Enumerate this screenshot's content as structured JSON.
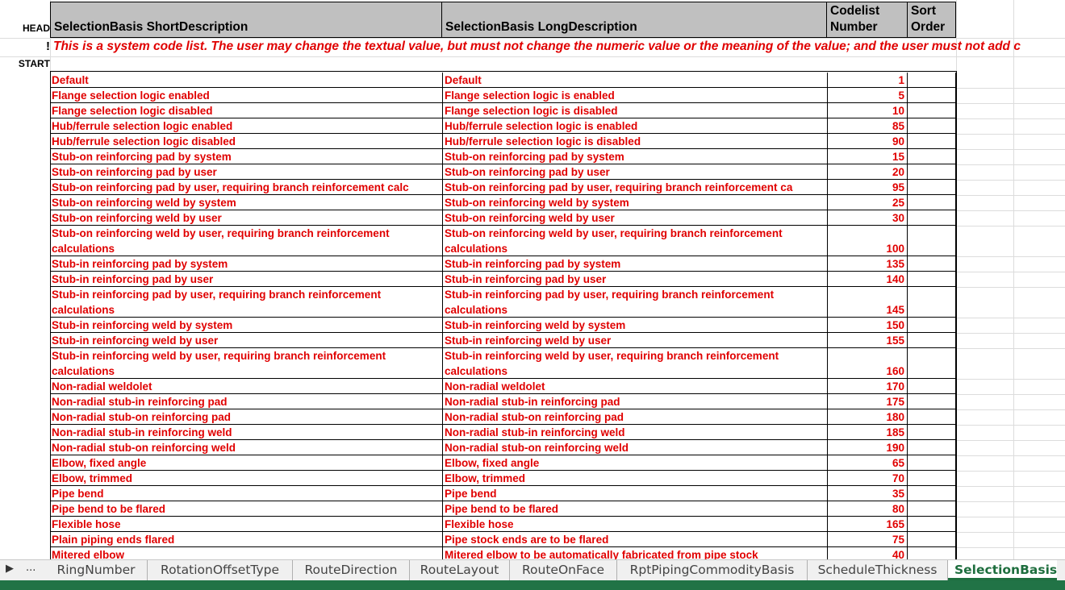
{
  "row_headers": {
    "head": "HEAD",
    "note_marker": "!",
    "start": "START"
  },
  "columns": {
    "short": "SelectionBasis ShortDescription",
    "long": "SelectionBasis LongDescription",
    "codelist": "Codelist Number",
    "sort": "Sort Order"
  },
  "note": "This is a system code list. The user may change the textual value, but must not change the numeric value or the meaning of the value; and the user must not add c",
  "rows": [
    {
      "short": "Default",
      "long": "Default",
      "num": "1"
    },
    {
      "short": "Flange selection logic enabled",
      "long": "Flange selection logic is enabled",
      "num": "5"
    },
    {
      "short": "Flange selection logic disabled",
      "long": "Flange selection logic is disabled",
      "num": "10"
    },
    {
      "short": "Hub/ferrule selection logic enabled",
      "long": "Hub/ferrule selection logic is enabled",
      "num": "85"
    },
    {
      "short": "Hub/ferrule selection logic disabled",
      "long": "Hub/ferrule selection logic is disabled",
      "num": "90"
    },
    {
      "short": "Stub-on reinforcing pad by system",
      "long": "Stub-on reinforcing pad by system",
      "num": "15"
    },
    {
      "short": "Stub-on reinforcing pad by user",
      "long": "Stub-on reinforcing pad by user",
      "num": "20"
    },
    {
      "short": "Stub-on reinforcing pad by user, requiring branch reinforcement calc",
      "long": "Stub-on reinforcing pad by user, requiring branch reinforcement ca",
      "num": "95"
    },
    {
      "short": "Stub-on reinforcing weld by system",
      "long": "Stub-on reinforcing weld by system",
      "num": "25"
    },
    {
      "short": "Stub-on reinforcing weld by user",
      "long": "Stub-on reinforcing weld by user",
      "num": "30"
    },
    {
      "short": "Stub-on reinforcing weld by user, requiring branch reinforcement calculations",
      "long": "Stub-on reinforcing weld by user, requiring branch reinforcement calculations",
      "num": "100",
      "wrap": true
    },
    {
      "short": "Stub-in reinforcing pad by system",
      "long": "Stub-in reinforcing pad by system",
      "num": "135"
    },
    {
      "short": "Stub-in reinforcing pad by user",
      "long": "Stub-in reinforcing pad by user",
      "num": "140"
    },
    {
      "short": "Stub-in reinforcing pad by user, requiring branch reinforcement calculations",
      "long": "Stub-in reinforcing pad by user, requiring branch reinforcement calculations",
      "num": "145",
      "wrap": true
    },
    {
      "short": "Stub-in reinforcing weld by system",
      "long": "Stub-in reinforcing weld by system",
      "num": "150"
    },
    {
      "short": "Stub-in reinforcing weld by user",
      "long": "Stub-in reinforcing weld by user",
      "num": "155"
    },
    {
      "short": "Stub-in reinforcing weld by user, requiring branch reinforcement calculations",
      "long": "Stub-in reinforcing weld by user, requiring branch reinforcement calculations",
      "num": "160",
      "wrap": true
    },
    {
      "short": "Non-radial weldolet",
      "long": "Non-radial weldolet",
      "num": "170"
    },
    {
      "short": "Non-radial stub-in reinforcing pad",
      "long": "Non-radial stub-in reinforcing pad",
      "num": "175"
    },
    {
      "short": "Non-radial stub-on reinforcing pad",
      "long": "Non-radial stub-on reinforcing pad",
      "num": "180"
    },
    {
      "short": "Non-radial stub-in reinforcing weld",
      "long": "Non-radial stub-in reinforcing weld",
      "num": "185"
    },
    {
      "short": "Non-radial stub-on reinforcing weld",
      "long": "Non-radial stub-on reinforcing weld",
      "num": "190"
    },
    {
      "short": "Elbow, fixed angle",
      "long": "Elbow, fixed angle",
      "num": "65"
    },
    {
      "short": "Elbow, trimmed",
      "long": "Elbow, trimmed",
      "num": "70"
    },
    {
      "short": "Pipe bend",
      "long": "Pipe bend",
      "num": "35"
    },
    {
      "short": "Pipe bend to be flared",
      "long": "Pipe bend to be flared",
      "num": "80"
    },
    {
      "short": "Flexible hose",
      "long": "Flexible hose",
      "num": "165"
    },
    {
      "short": "Plain piping ends flared",
      "long": "Pipe stock ends are to be flared",
      "num": "75"
    },
    {
      "short": "Mitered elbow",
      "long": "Mitered elbow to be automatically fabricated from pipe stock",
      "num": "40"
    }
  ],
  "tabs": {
    "nav_prev_icon": "triangle-right-icon",
    "ellipsis": "...",
    "items": [
      "RingNumber",
      "RotationOffsetType",
      "RouteDirection",
      "RouteLayout",
      "RouteOnFace",
      "RptPipingCommodityBasis",
      "ScheduleThickness",
      "SelectionBasis"
    ],
    "active": "SelectionBasis"
  },
  "colors": {
    "text_red": "#e00000",
    "header_gray": "#c0c0c0",
    "accent_green": "#217346"
  }
}
